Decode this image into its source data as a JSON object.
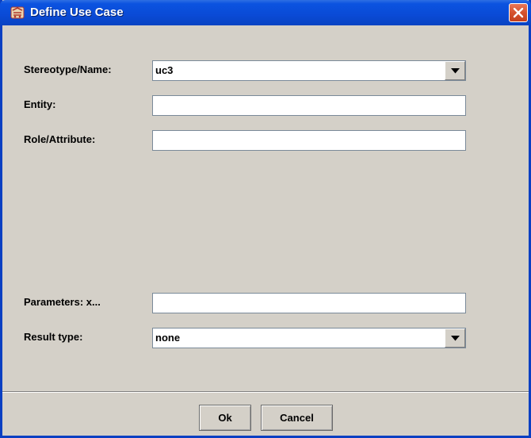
{
  "window": {
    "title": "Define Use Case"
  },
  "form": {
    "stereotype_label": "Stereotype/Name:",
    "stereotype_value": "uc3",
    "entity_label": "Entity:",
    "entity_value": "",
    "role_label": "Role/Attribute:",
    "role_value": "",
    "parameters_label": "Parameters: x...",
    "parameters_value": "",
    "result_label": "Result type:",
    "result_value": "none"
  },
  "buttons": {
    "ok_label": "Ok",
    "cancel_label": "Cancel"
  },
  "icons": {
    "title": "app-icon",
    "close": "close-icon",
    "dropdown": "chevron-down-icon"
  },
  "colors": {
    "titlebar": "#0a4ad6",
    "background": "#d4d0c8",
    "close": "#d5522e"
  }
}
